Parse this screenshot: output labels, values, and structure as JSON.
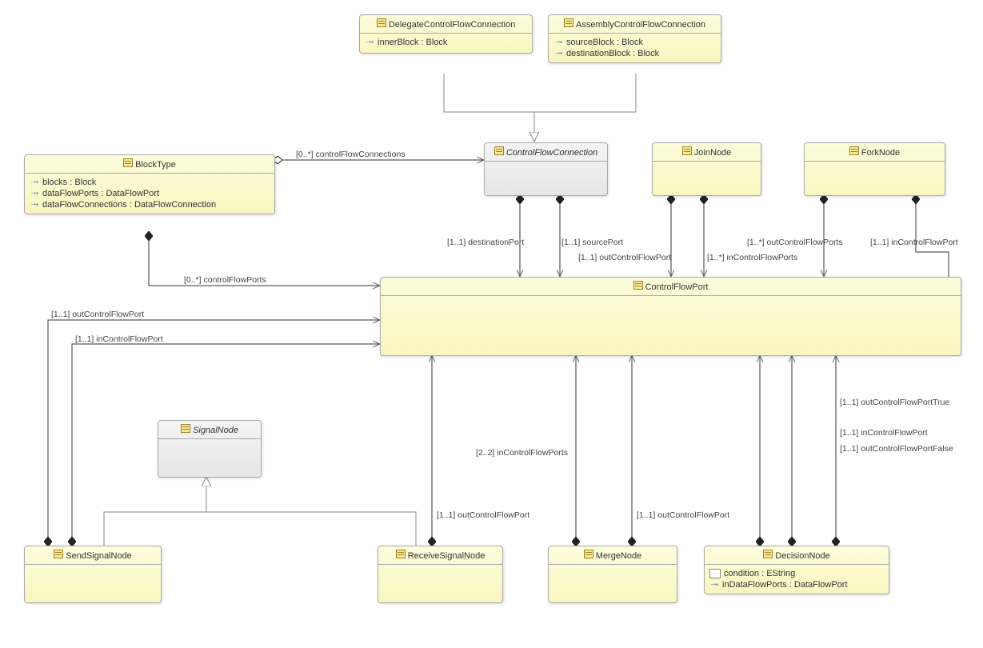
{
  "classes": {
    "delegate": {
      "name": "DelegateControlFlowConnection",
      "attrs": [
        "innerBlock : Block"
      ]
    },
    "assembly": {
      "name": "AssemblyControlFlowConnection",
      "attrs": [
        "sourceBlock : Block",
        "destinationBlock : Block"
      ]
    },
    "cfc": {
      "name": "ControlFlowConnection"
    },
    "joinNode": {
      "name": "JoinNode"
    },
    "forkNode": {
      "name": "ForkNode"
    },
    "blockType": {
      "name": "BlockType",
      "attrs": [
        "blocks : Block",
        "dataFlowPorts : DataFlowPort",
        "dataFlowConnections : DataFlowConnection"
      ]
    },
    "cfp": {
      "name": "ControlFlowPort"
    },
    "signalNode": {
      "name": "SignalNode"
    },
    "sendSignal": {
      "name": "SendSignalNode"
    },
    "receiveSignal": {
      "name": "ReceiveSignalNode"
    },
    "mergeNode": {
      "name": "MergeNode"
    },
    "decisionNode": {
      "name": "DecisionNode",
      "attrs": [
        "condition : EString",
        "inDataFlowPorts : DataFlowPort"
      ]
    }
  },
  "labels": {
    "cfConns": "[0..*] controlFlowConnections",
    "destPort": "[1..1] destinationPort",
    "srcPort": "[1..1] sourcePort",
    "cfPorts": "[0..*] controlFlowPorts",
    "outCFP": "[1..1] outControlFlowPort",
    "inCFP": "[1..1] inControlFlowPort",
    "inCFPs": "[1..*] inControlFlowPorts",
    "inCFPs22": "[2..2] inControlFlowPorts",
    "outCFPs": "[1..*] outControlFlowPorts",
    "outCFPTrue": "[1..1] outControlFlowPortTrue",
    "outCFPFalse": "[1..1] outControlFlowPortFalse"
  }
}
